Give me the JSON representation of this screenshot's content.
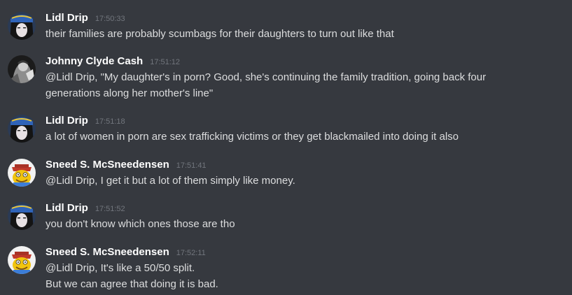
{
  "messages": [
    {
      "author": "Lidl Drip",
      "timestamp": "17:50:33",
      "avatar_icon": "dark-hair-blue-hat-avatar",
      "lines": [
        "their families are probably scumbags for their daughters to turn out like that"
      ]
    },
    {
      "author": "Johnny Clyde Cash",
      "timestamp": "17:51:12",
      "avatar_icon": "black-white-photo-avatar",
      "lines": [
        "@Lidl Drip, \"My daughter's in porn? Good, she's continuing the family tradition, going back four",
        "generations along her mother's line\""
      ]
    },
    {
      "author": "Lidl Drip",
      "timestamp": "17:51:18",
      "avatar_icon": "dark-hair-blue-hat-avatar",
      "lines": [
        "a lot of women in porn are sex trafficking victims or they get blackmailed into doing it also"
      ]
    },
    {
      "author": "Sneed S. McSneedensen",
      "timestamp": "17:51:41",
      "avatar_icon": "cartoon-character-avatar",
      "lines": [
        "@Lidl Drip, I get it but a lot of them simply like money."
      ]
    },
    {
      "author": "Lidl Drip",
      "timestamp": "17:51:52",
      "avatar_icon": "dark-hair-blue-hat-avatar",
      "lines": [
        "you don't know which ones those are tho"
      ]
    },
    {
      "author": "Sneed S. McSneedensen",
      "timestamp": "17:52:11",
      "avatar_icon": "cartoon-character-avatar",
      "lines": [
        "@Lidl Drip, It's like a 50/50 split.",
        "But we can agree that doing it is bad."
      ]
    }
  ],
  "colors": {
    "background": "#36393f",
    "username": "#ffffff",
    "message_text": "#dcddde",
    "timestamp": "#72767d"
  }
}
